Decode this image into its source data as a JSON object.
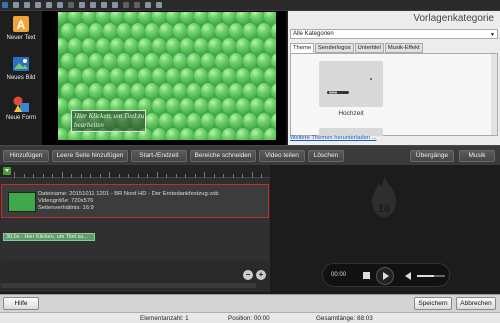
{
  "toolbar": {
    "icons": [
      "app-logo-icon",
      "new-icon",
      "cut-icon",
      "delete-icon",
      "copy-icon",
      "paste-icon",
      "undo-icon",
      "zoom-in-icon",
      "zoom-out-icon",
      "zoom-fit-icon",
      "zoom-reset-icon",
      "rotate-left-icon",
      "rotate-right-icon",
      "export-icon",
      "settings-icon"
    ]
  },
  "tools": {
    "new_text": "Neuer Text",
    "new_image": "Neues Bild",
    "new_shape": "Neue Form"
  },
  "preview": {
    "overlay_text": "Hier Klicken, um Titel zu bearbeiten"
  },
  "right_panel": {
    "title": "Vorlagenkategorie",
    "category_select": "Alle Kategorien",
    "tabs": [
      "Theme",
      "Senderlogos",
      "Untertitel",
      "Musik-Effekt"
    ],
    "active_tab": "Theme",
    "template_label": "Hochzeit",
    "more_link": "Weitere Themen herunterladen ..."
  },
  "action_bar": {
    "add": "Hinzufügen",
    "add_empty": "Leere Seite hinzufügen",
    "start_end": "Start-/Endzeit",
    "cut_regions": "Bereiche schneiden",
    "split_video": "Video teilen",
    "delete": "Löschen",
    "transitions": "Übergänge",
    "music": "Musik"
  },
  "timeline": {
    "clip": {
      "filename": "Dateiname: 20151011 1201 - BR Nord HD - Der Erntedankfestzug.vob",
      "size": "Videogröße: 720x576",
      "aspect": "Seitenverhältnis: 16:9"
    },
    "text_clip": "30,0s - Hier Klicken, um Titel zu..."
  },
  "player": {
    "time": "00:00",
    "volume": 0.6
  },
  "bottom": {
    "help": "Hilfe",
    "save": "Speichern",
    "cancel": "Abbrechen"
  },
  "status": {
    "count": "Elementanzahl: 1",
    "position": "Position: 00:00",
    "total": "Gesamtlänge: 88:03"
  }
}
